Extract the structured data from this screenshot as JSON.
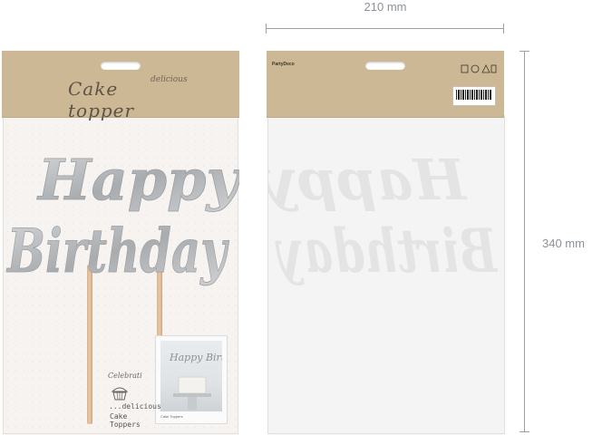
{
  "dimensions": {
    "width_label": "210 mm",
    "height_label": "340 mm"
  },
  "front": {
    "header_title": "Cake topper",
    "header_subtitle": "delicious",
    "topper_line1": "Happy",
    "topper_line2": "Birthday",
    "photo_card_text": "Happy Birthday",
    "photo_caption": "Cake Toppers",
    "bottom_logo": "Celebrati",
    "bottom_tagline": "...delicious",
    "bottom_name": "Cake Toppers"
  },
  "back": {
    "brand": "PartyDeco",
    "colors": {
      "kraft": "#cdb896",
      "silver": "#c4c6c8",
      "sleeve": "#f4f4f4"
    }
  }
}
